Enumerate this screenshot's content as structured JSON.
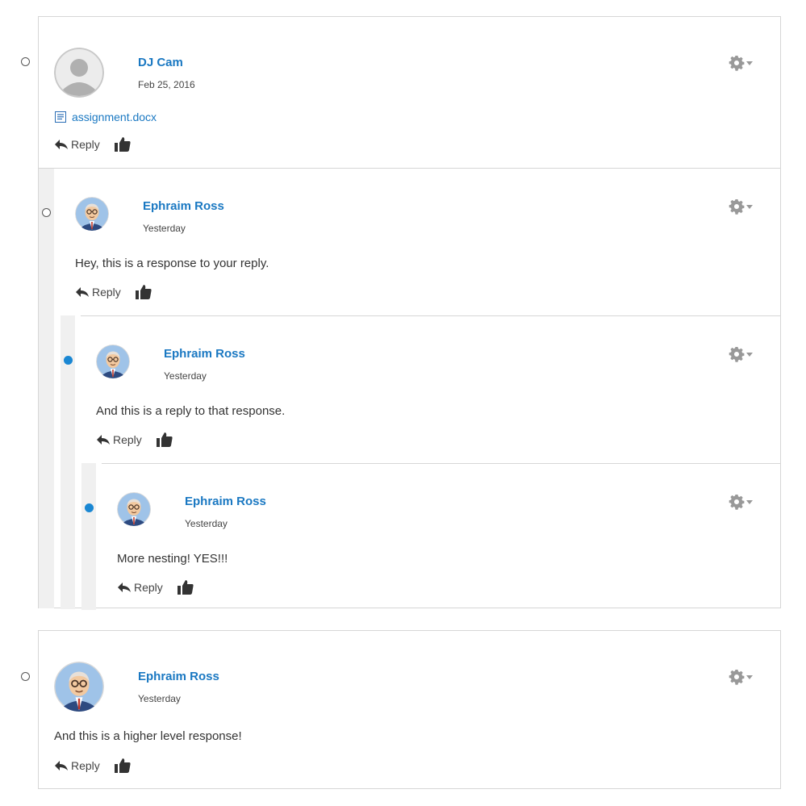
{
  "comments": [
    {
      "author": "DJ Cam",
      "date": "Feb 25, 2016",
      "attachment": "assignment.docx",
      "reply_label": "Reply",
      "status": "read",
      "avatar": "default-avatar"
    },
    {
      "author": "Ephraim Ross",
      "date": "Yesterday",
      "text": "Hey, this is a response to your reply.",
      "reply_label": "Reply",
      "status": "read",
      "avatar": "cartoon-avatar"
    },
    {
      "author": "Ephraim Ross",
      "date": "Yesterday",
      "text": "And this is a reply to that response.",
      "reply_label": "Reply",
      "status": "unread",
      "avatar": "cartoon-avatar"
    },
    {
      "author": "Ephraim Ross",
      "date": "Yesterday",
      "text": "More nesting! YES!!!",
      "reply_label": "Reply",
      "status": "unread",
      "avatar": "cartoon-avatar"
    },
    {
      "author": "Ephraim Ross",
      "date": "Yesterday",
      "text": "And this is a higher level response!",
      "reply_label": "Reply",
      "status": "read",
      "avatar": "cartoon-avatar"
    }
  ],
  "icons": {
    "reply": "reply-arrow-icon",
    "like": "thumbs-up-icon",
    "settings": "gear-icon",
    "dropdown": "caret-down-icon",
    "attachment": "word-document-icon"
  },
  "colors": {
    "link": "#1a78c2",
    "unread_dot": "#1a87d3",
    "border": "#d6d6d6",
    "indent": "#f0f0f0"
  }
}
